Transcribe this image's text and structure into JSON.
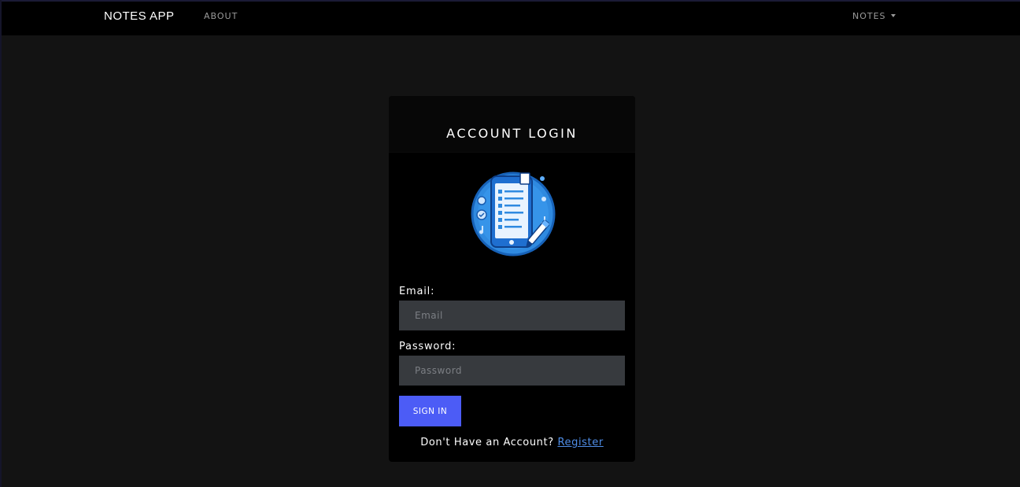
{
  "navbar": {
    "brand": "NOTES APP",
    "about_label": "ABOUT",
    "notes_label": "NOTES"
  },
  "login": {
    "title": "ACCOUNT LOGIN",
    "logo_icon": "notes-phone-logo-icon",
    "email_label": "Email:",
    "email_placeholder": "Email",
    "email_value": "",
    "password_label": "Password:",
    "password_placeholder": "Password",
    "password_value": "",
    "submit_label": "SIGN IN",
    "footer_prompt": "Don't Have an Account?",
    "register_link": "Register"
  },
  "colors": {
    "background": "#131313",
    "navbar": "#000000",
    "card": "#000000",
    "input_bg": "#373a3e",
    "button": "#4c5cf6",
    "link": "#4f8de6"
  }
}
